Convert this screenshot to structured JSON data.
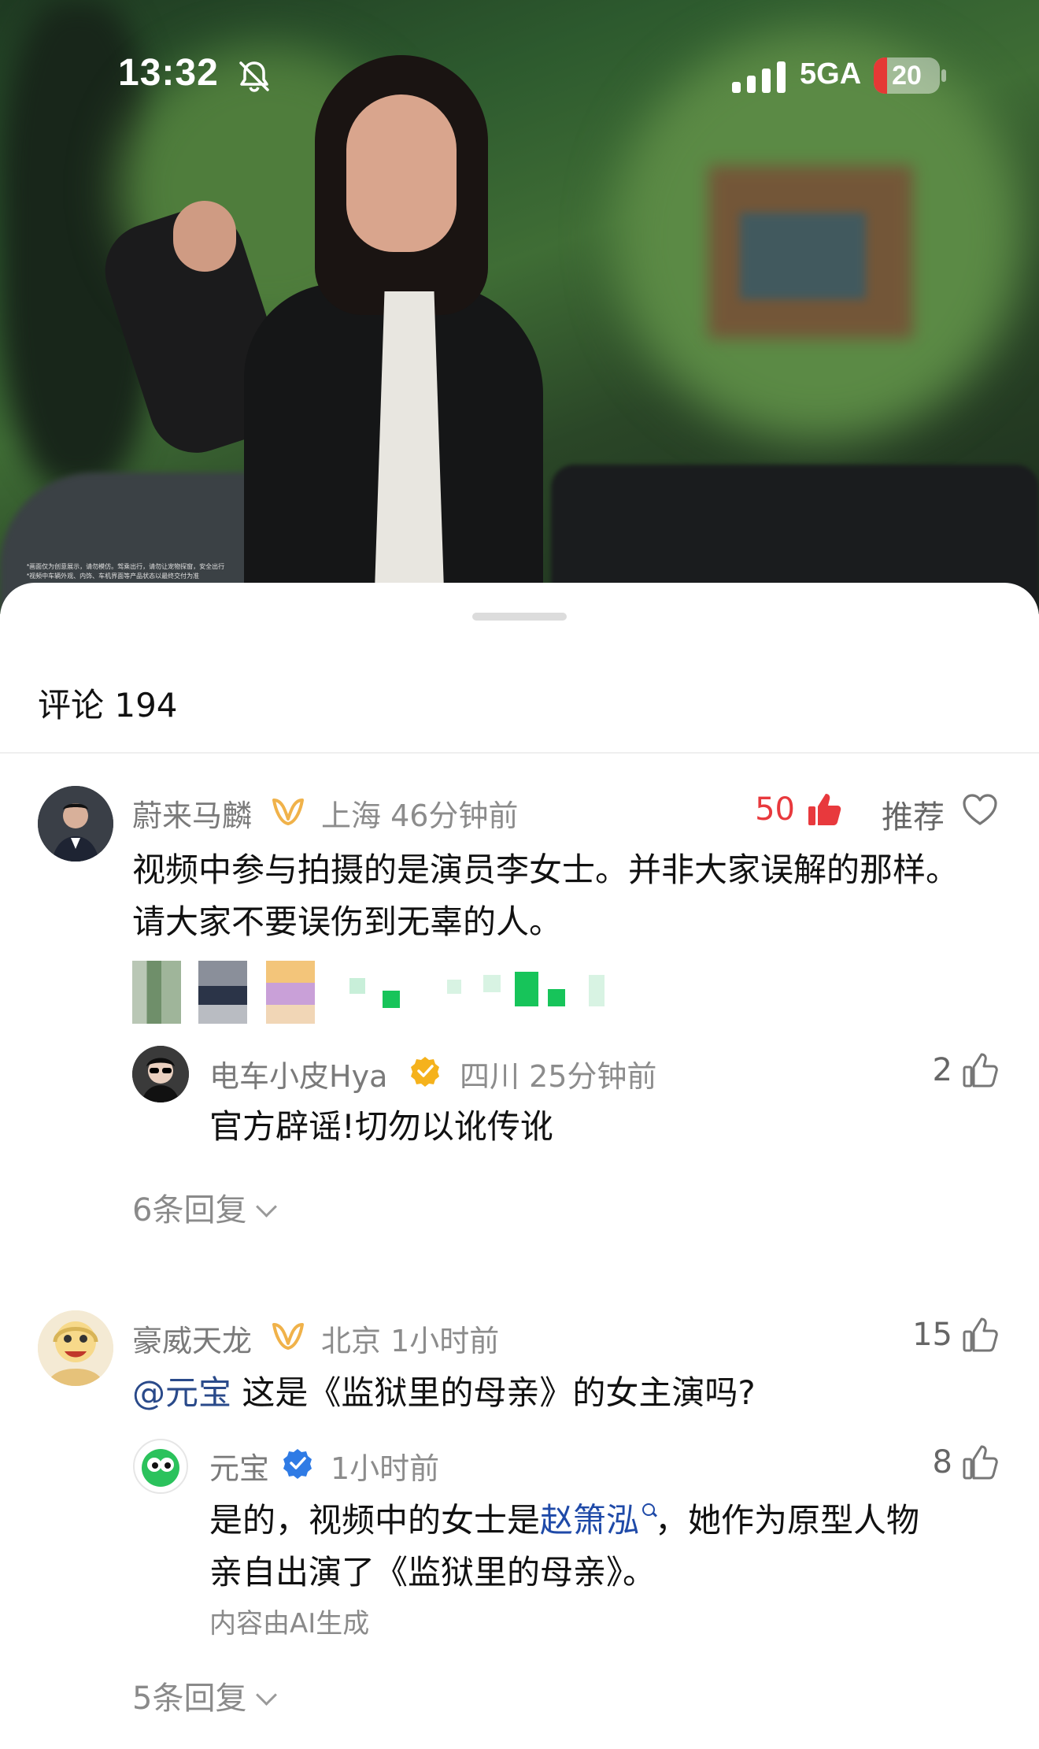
{
  "status_bar": {
    "time": "13:32",
    "network": "5GA",
    "battery": "20",
    "battery_level": 0.2,
    "icons": [
      "bell-mute-icon",
      "signal-icon"
    ]
  },
  "video": {
    "disclaimer_line1": "*画面仅为创意展示，请勿模仿。驾乘出行，请勿让宠物探窗，安全出行",
    "disclaimer_line2": "*视频中车辆外观、内饰、车机界面等产品状态以最终交付为准"
  },
  "comments_header": {
    "title": "评论 194"
  },
  "comments": [
    {
      "user": "蔚来马麟",
      "location_time": "上海 46分钟前",
      "likes": "50",
      "recommend": "推荐",
      "text_line1": "视频中参与拍摄的是演员李女士。并非大家误解的那样。",
      "text_line2": "请大家不要误伤到无辜的人。",
      "reply": {
        "user": "电车小皮Hya",
        "location_time": "四川 25分钟前",
        "likes": "2",
        "text": "官方辟谣!切勿以讹传讹"
      },
      "more_replies": "6条回复"
    },
    {
      "user": "豪威天龙",
      "location_time": "北京 1小时前",
      "likes": "15",
      "mention": "@元宝",
      "text": "这是《监狱里的母亲》的女主演吗?",
      "reply": {
        "user": "元宝",
        "location_time": "1小时前",
        "likes": "8",
        "text_pre": "是的，视频中的女士是",
        "text_link": "赵箫泓",
        "text_post": "，她作为原型人物",
        "text_line2": "亲自出演了《监狱里的母亲》。",
        "ai_note": "内容由AI生成"
      },
      "more_replies": "5条回复"
    }
  ],
  "colors": {
    "like_red": "#e8393d",
    "vip_gold": "#f0b24a",
    "verify_gold": "#f5b21c",
    "verify_blue": "#2f7be5",
    "mention_blue": "#2a4a8a",
    "link_blue": "#1f4aa8"
  }
}
